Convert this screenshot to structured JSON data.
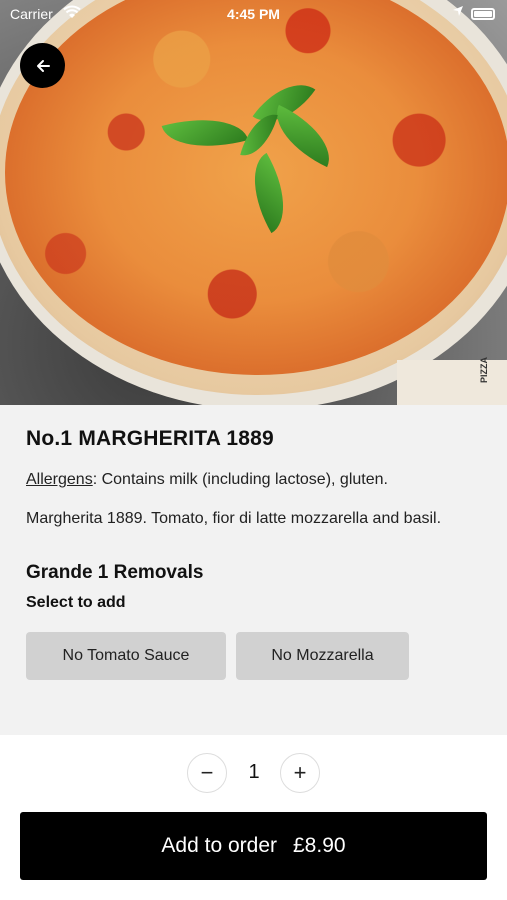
{
  "status_bar": {
    "carrier": "Carrier",
    "time": "4:45 PM"
  },
  "hero": {
    "box_text": "PIZZA"
  },
  "product": {
    "title": "No.1 MARGHERITA 1889",
    "allergens_label": "Allergens",
    "allergens_text": ": Contains milk (including lactose), gluten.",
    "description": "Margherita 1889. Tomato, fior di latte mozzarella and basil."
  },
  "removals": {
    "title": "Grande 1 Removals",
    "subtitle": "Select to add",
    "options": [
      "No Tomato Sauce",
      "No Mozzarella"
    ]
  },
  "quantity": {
    "minus": "−",
    "value": "1",
    "plus": "+"
  },
  "add_button": {
    "label": "Add to order",
    "price": "£8.90"
  }
}
